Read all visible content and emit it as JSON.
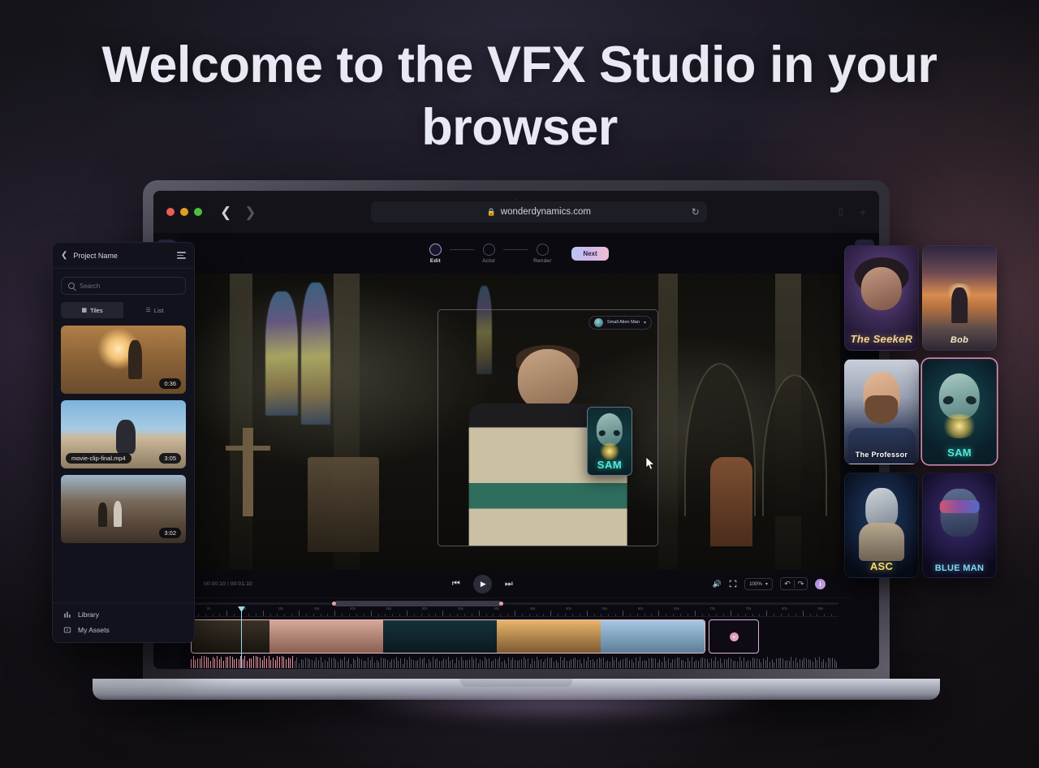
{
  "hero": {
    "headline": "Welcome to the VFX Studio in your browser"
  },
  "browser": {
    "url": "wonderdynamics.com",
    "lock_icon": "lock-icon",
    "reload_icon": "reload-icon",
    "back_icon": "chevron-left-icon",
    "forward_icon": "chevron-right-icon"
  },
  "left_rail": {
    "items": [
      {
        "name": "clips-tool",
        "icon": "clapperboard-icon",
        "active": true
      },
      {
        "name": "adjustments-tool",
        "icon": "sliders-icon",
        "active": false
      },
      {
        "name": "effects-tool",
        "icon": "magic-wand-icon",
        "active": false
      }
    ]
  },
  "stepper": {
    "steps": [
      {
        "label": "Edit",
        "state": "current"
      },
      {
        "label": "Actor",
        "state": "upcoming"
      },
      {
        "label": "Render",
        "state": "upcoming"
      }
    ],
    "next_label": "Next"
  },
  "viewer": {
    "actor_tag": {
      "label": "Small Alien Man",
      "chevron": "chevron-down-icon",
      "avatar": "actor-avatar"
    },
    "drag_card_label": "SAM",
    "cursor": "drag-cursor"
  },
  "transport": {
    "timecode": "00:00:10 / 00:01:10",
    "prev_icon": "skip-previous-icon",
    "play_icon": "play-icon",
    "next_icon": "skip-next-icon",
    "volume_icon": "volume-icon",
    "fit_icon": "fit-to-screen-icon",
    "zoom_value": "100%",
    "zoom_chevron": "chevron-down-icon",
    "undo_icon": "undo-icon",
    "redo_icon": "redo-icon",
    "info_label": "i"
  },
  "timeline": {
    "ruler_labels": [
      "0s",
      "5s",
      "10s",
      "15s",
      "20s",
      "25s",
      "30s",
      "35s",
      "40s",
      "45s",
      "50s",
      "55s",
      "60s",
      "65s",
      "70s",
      "75s",
      "80s",
      "85s"
    ],
    "clips": [
      {
        "name": "clip-cathedral"
      },
      {
        "name": "clip-closeup"
      },
      {
        "name": "clip-neon"
      },
      {
        "name": "clip-sunset"
      },
      {
        "name": "clip-sky"
      }
    ],
    "add_clip_label": "+"
  },
  "right_rail": {
    "items": [
      {
        "name": "actors-panel",
        "icon": "person-icon",
        "active": true
      },
      {
        "name": "actor-settings-panel",
        "icon": "person-settings-icon",
        "active": false
      }
    ]
  },
  "assets_panel": {
    "back_icon": "chevron-left-icon",
    "title": "Project Name",
    "menu_icon": "hamburger-icon",
    "search": {
      "placeholder": "Search",
      "value": "",
      "icon": "search-icon"
    },
    "view_toggle": [
      {
        "label": "Tiles",
        "icon": "tiles-icon",
        "active": true
      },
      {
        "label": "List",
        "icon": "list-icon",
        "active": false
      }
    ],
    "tiles": [
      {
        "name": "",
        "duration": "0:36"
      },
      {
        "name": "movie-clip-final.mp4",
        "duration": "3:05"
      },
      {
        "name": "",
        "duration": "3:02"
      }
    ],
    "footer": [
      {
        "label": "Library",
        "icon": "library-icon"
      },
      {
        "label": "My Assets",
        "icon": "my-assets-icon"
      }
    ]
  },
  "characters": [
    {
      "name": "The SeekeR",
      "key": "seeker",
      "selected": false
    },
    {
      "name": "Bob",
      "key": "bob",
      "selected": false
    },
    {
      "name": "The Professor",
      "key": "professor",
      "selected": false
    },
    {
      "name": "SAM",
      "key": "sam",
      "selected": true
    },
    {
      "name": "ASC",
      "key": "asc",
      "selected": false
    },
    {
      "name": "BLUE MAN",
      "key": "blueman",
      "selected": false
    }
  ],
  "colors": {
    "accent_gradient_start": "#b9c6f2",
    "accent_gradient_end": "#f0c0d2",
    "selected_border": "#d9b2e0",
    "sam_teal": "#4fe8d8",
    "playhead": "#9fd8e8"
  }
}
